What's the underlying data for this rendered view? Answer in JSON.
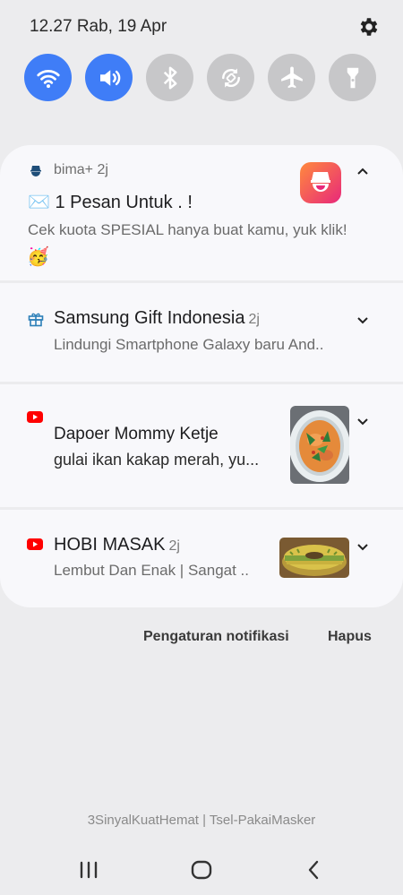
{
  "status": {
    "datetime": "12.27 Rab, 19 Apr"
  },
  "quick_settings": [
    {
      "name": "wifi-icon",
      "state": "on"
    },
    {
      "name": "sound-icon",
      "state": "on"
    },
    {
      "name": "bluetooth-icon",
      "state": "off"
    },
    {
      "name": "auto-rotate-icon",
      "state": "off"
    },
    {
      "name": "airplane-icon",
      "state": "off"
    },
    {
      "name": "flashlight-icon",
      "state": "off"
    }
  ],
  "colors": {
    "accent": "#3f7df7",
    "tile_off": "#c7c7c9",
    "youtube_red": "#ff0000",
    "bima_orange": "#ff5a3c",
    "gift_blue": "#2c7fb8"
  },
  "notifications": [
    {
      "app": "bima+",
      "age": "2j",
      "title": "✉️ 1 Pesan Untuk  . !",
      "body": "Cek kuota SPESIAL hanya buat kamu, yuk klik!",
      "emoji": "🥳"
    },
    {
      "title": "Samsung Gift Indonesia",
      "age": "2j",
      "body": "Lindungi Smartphone Galaxy baru And.."
    },
    {
      "title": "Dapoer Mommy Ketje",
      "body": "gulai ikan kakap merah, yu..."
    },
    {
      "title": "HOBI MASAK",
      "age": "2j",
      "body": "Lembut Dan Enak | Sangat .."
    }
  ],
  "actions": {
    "settings": "Pengaturan notifikasi",
    "clear": "Hapus"
  },
  "carrier": "3SinyalKuatHemat | Tsel-PakaiMasker"
}
